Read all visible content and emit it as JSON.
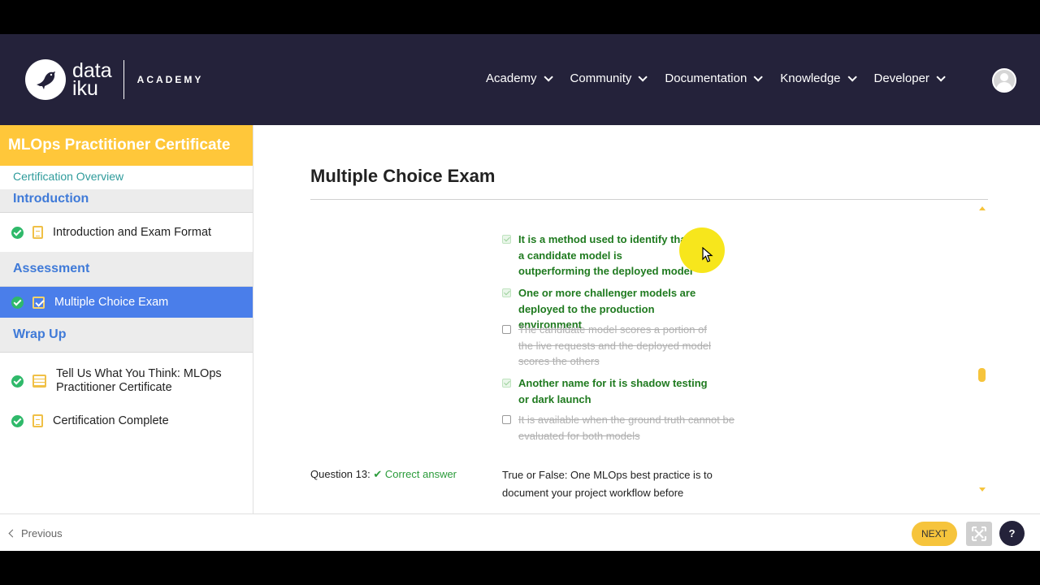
{
  "brand": {
    "word_top": "data",
    "word_bottom": "iku",
    "section": "ACADEMY"
  },
  "nav": {
    "items": [
      {
        "label": "Academy"
      },
      {
        "label": "Community"
      },
      {
        "label": "Documentation"
      },
      {
        "label": "Knowledge"
      },
      {
        "label": "Developer"
      }
    ]
  },
  "sidebar": {
    "course_title": "MLOps Practitioner Certificate",
    "overview_link": "Certification Overview",
    "sections": [
      {
        "title": "Introduction",
        "lessons": [
          {
            "label": "Introduction and Exam Format",
            "icon": "document-icon",
            "completed": true
          }
        ]
      },
      {
        "title": "Assessment",
        "lessons": [
          {
            "label": "Multiple Choice Exam",
            "icon": "quiz-icon",
            "completed": true,
            "active": true
          }
        ]
      },
      {
        "title": "Wrap Up",
        "lessons": [
          {
            "label": "Tell Us What You Think: MLOps Practitioner Certificate",
            "icon": "survey-icon",
            "completed": true
          },
          {
            "label": "Certification Complete",
            "icon": "document-icon",
            "completed": true
          }
        ]
      }
    ]
  },
  "main": {
    "page_title": "Multiple Choice Exam",
    "options": [
      {
        "text": "It is a method used to identify that a candidate model is outperforming the deployed model",
        "state": "selected-correct"
      },
      {
        "text": "One or more challenger models are deployed to the production environment",
        "state": "selected-correct"
      },
      {
        "text": "The candidate model scores a portion of the live requests and the deployed model scores the others",
        "state": "struck"
      },
      {
        "text": "Another name for it is shadow testing or dark launch",
        "state": "selected-correct"
      },
      {
        "text": "It is available when the ground truth cannot be evaluated for both models",
        "state": "struck"
      }
    ],
    "question13": {
      "label": "Question 13:",
      "status": "Correct answer",
      "text": "True or False: One MLOps best practice is to document your project workflow before"
    }
  },
  "footer": {
    "previous_label": "Previous",
    "next_label": "NEXT",
    "help_label": "?"
  },
  "colors": {
    "header_bg": "#24223a",
    "accent_yellow": "#ffc73a",
    "active_blue": "#4a7eea",
    "correct_green": "#1f7a1f"
  }
}
